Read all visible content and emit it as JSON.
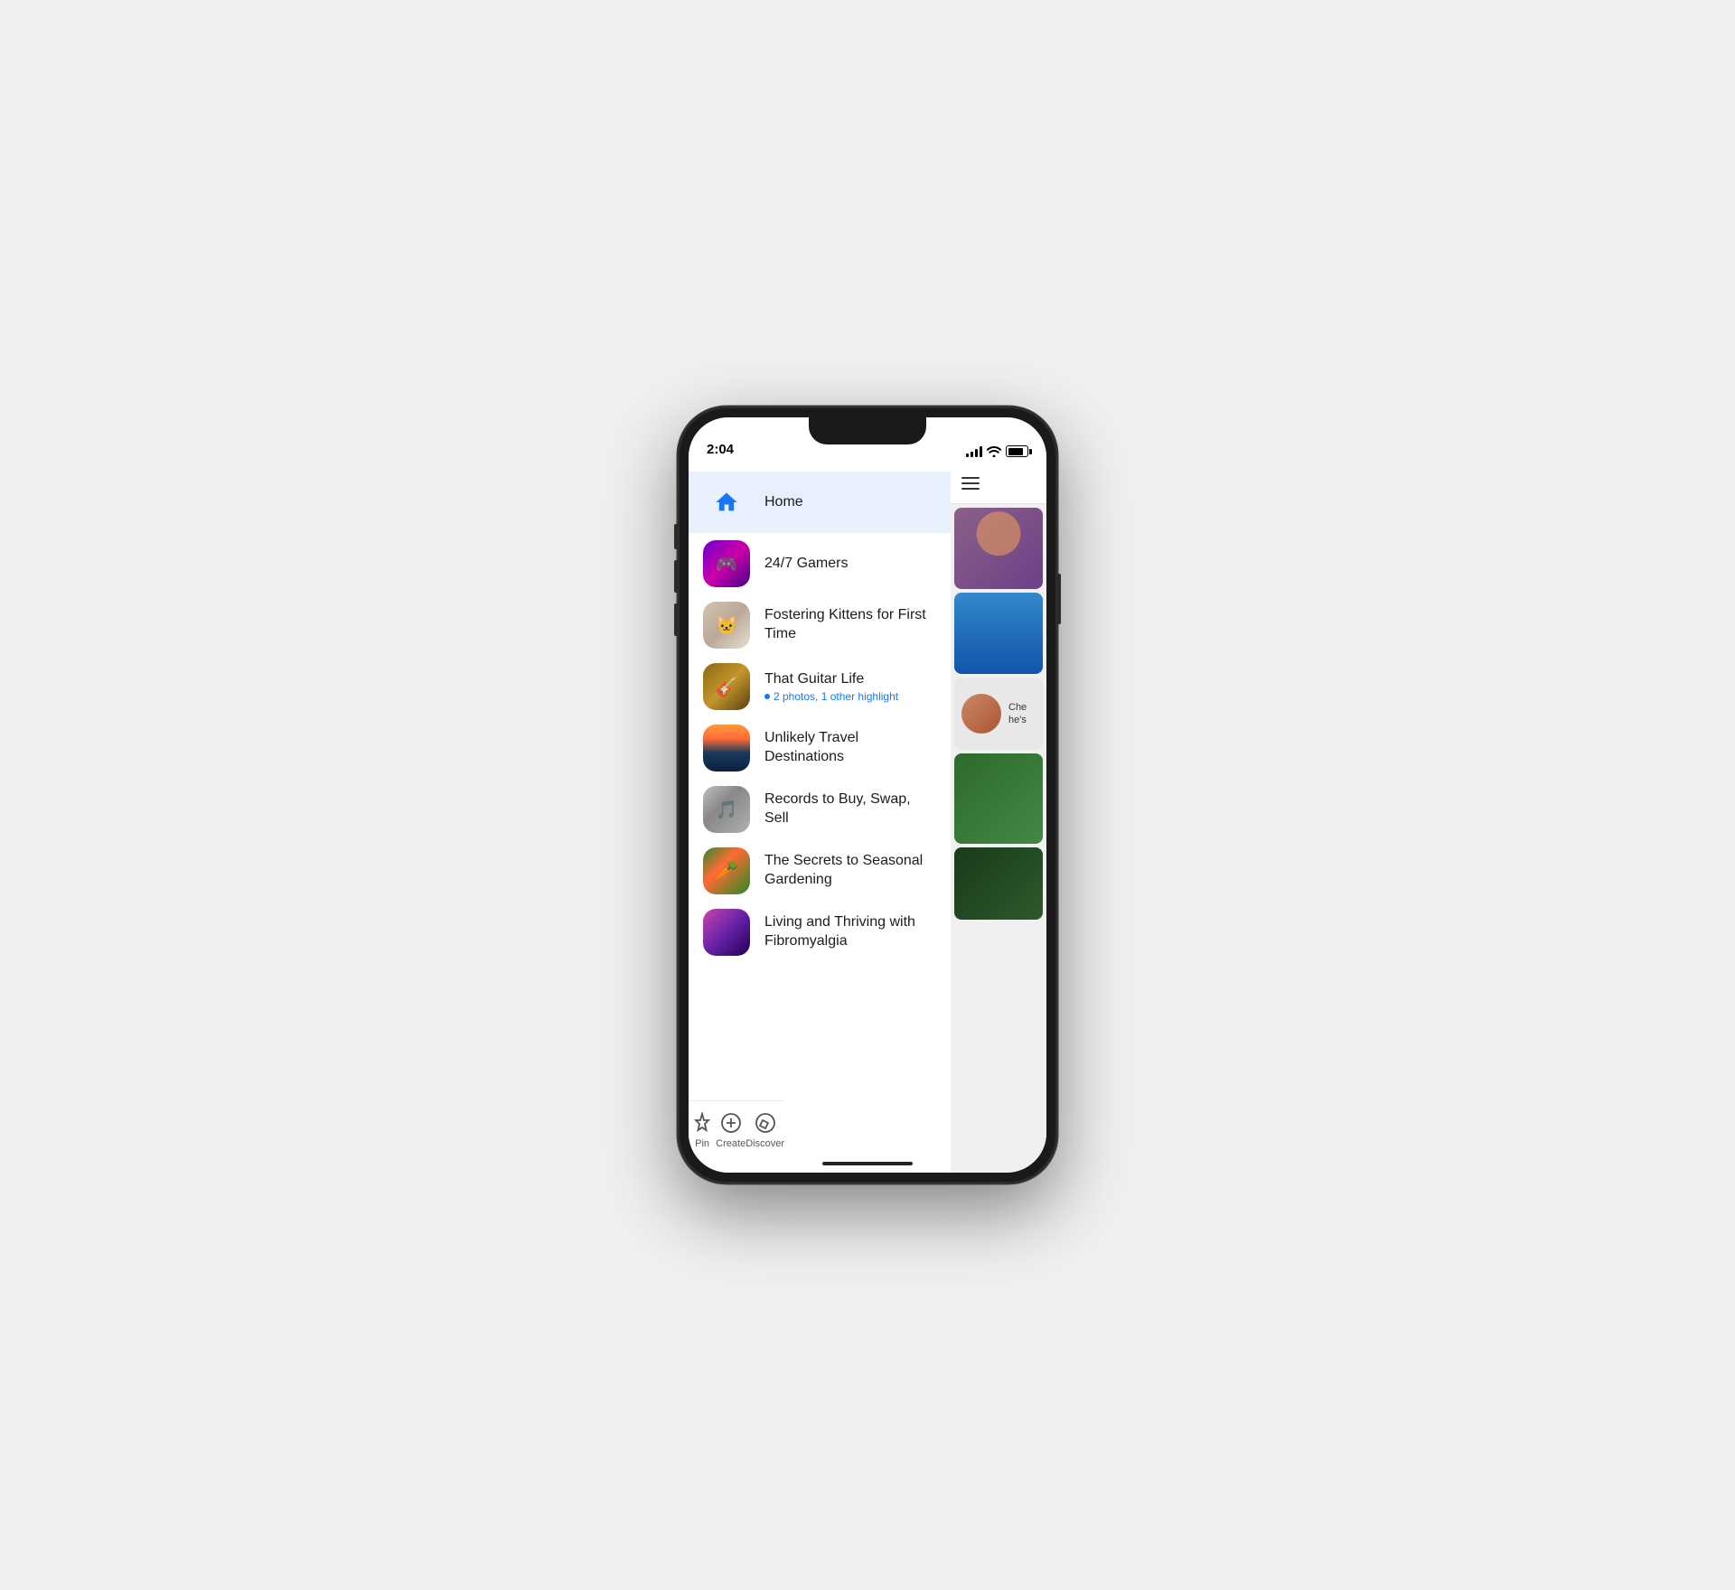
{
  "phone": {
    "time": "2:04",
    "status": {
      "signal": "signal",
      "wifi": "wifi",
      "battery": "battery"
    }
  },
  "sidebar": {
    "items": [
      {
        "id": "home",
        "title": "Home",
        "subtitle": null,
        "thumb_type": "home",
        "active": true
      },
      {
        "id": "gamers",
        "title": "24/7 Gamers",
        "subtitle": null,
        "thumb_type": "gamers",
        "active": false
      },
      {
        "id": "kittens",
        "title": "Fostering Kittens for First Time",
        "subtitle": null,
        "thumb_type": "kittens",
        "active": false
      },
      {
        "id": "guitar",
        "title": "That Guitar Life",
        "subtitle": "2 photos, 1 other highlight",
        "thumb_type": "guitar",
        "active": false
      },
      {
        "id": "travel",
        "title": "Unlikely Travel Destinations",
        "subtitle": null,
        "thumb_type": "travel",
        "active": false
      },
      {
        "id": "records",
        "title": "Records to Buy, Swap, Sell",
        "subtitle": null,
        "thumb_type": "records",
        "active": false
      },
      {
        "id": "gardening",
        "title": "The Secrets to Seasonal Gardening",
        "subtitle": null,
        "thumb_type": "gardening",
        "active": false
      },
      {
        "id": "fibro",
        "title": "Living and Thriving with Fibromyalgia",
        "subtitle": null,
        "thumb_type": "fibro",
        "active": false
      }
    ]
  },
  "tabs": [
    {
      "id": "pin",
      "label": "Pin",
      "icon": "pin-icon"
    },
    {
      "id": "create",
      "label": "Create",
      "icon": "create-icon"
    },
    {
      "id": "discover",
      "label": "Discover",
      "icon": "discover-icon"
    }
  ],
  "peek": {
    "card3_text": "Che he's"
  }
}
